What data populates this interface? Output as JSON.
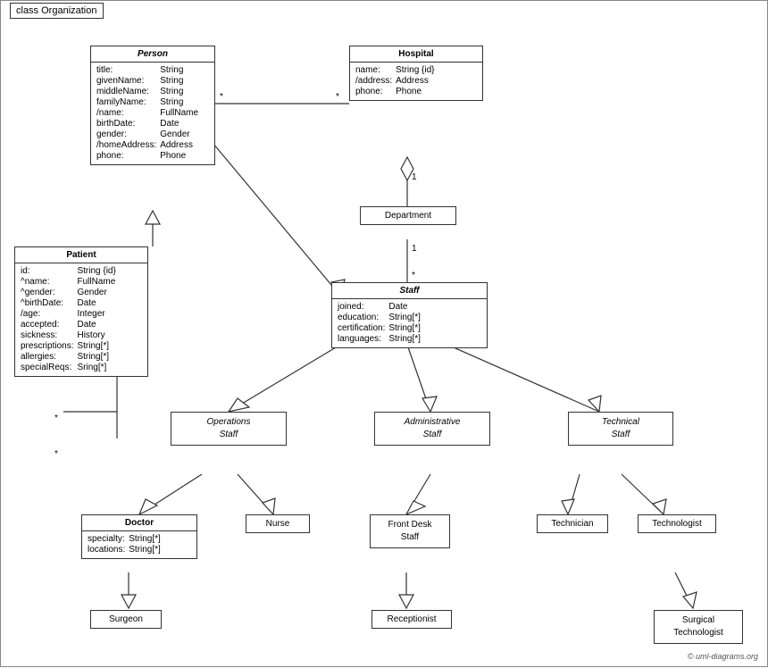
{
  "diagram": {
    "title": "class Organization",
    "classes": {
      "person": {
        "name": "Person",
        "italic": true,
        "attrs": [
          [
            "title:",
            "String"
          ],
          [
            "givenName:",
            "String"
          ],
          [
            "middleName:",
            "String"
          ],
          [
            "familyName:",
            "String"
          ],
          [
            "/name:",
            "FullName"
          ],
          [
            "birthDate:",
            "Date"
          ],
          [
            "gender:",
            "Gender"
          ],
          [
            "/homeAddress:",
            "Address"
          ],
          [
            "phone:",
            "Phone"
          ]
        ]
      },
      "hospital": {
        "name": "Hospital",
        "attrs": [
          [
            "name:",
            "String {id}"
          ],
          [
            "/address:",
            "Address"
          ],
          [
            "phone:",
            "Phone"
          ]
        ]
      },
      "patient": {
        "name": "Patient",
        "attrs": [
          [
            "id:",
            "String {id}"
          ],
          [
            "^name:",
            "FullName"
          ],
          [
            "^gender:",
            "Gender"
          ],
          [
            "^birthDate:",
            "Date"
          ],
          [
            "/age:",
            "Integer"
          ],
          [
            "accepted:",
            "Date"
          ],
          [
            "sickness:",
            "History"
          ],
          [
            "prescriptions:",
            "String[*]"
          ],
          [
            "allergies:",
            "String[*]"
          ],
          [
            "specialReqs:",
            "Sring[*]"
          ]
        ]
      },
      "department": {
        "name": "Department"
      },
      "staff": {
        "name": "Staff",
        "italic": true,
        "attrs": [
          [
            "joined:",
            "Date"
          ],
          [
            "education:",
            "String[*]"
          ],
          [
            "certification:",
            "String[*]"
          ],
          [
            "languages:",
            "String[*]"
          ]
        ]
      },
      "operationsStaff": {
        "name": "Operations\nStaff",
        "italic": true
      },
      "administrativeStaff": {
        "name": "Administrative\nStaff",
        "italic": true
      },
      "technicalStaff": {
        "name": "Technical\nStaff",
        "italic": true
      },
      "doctor": {
        "name": "Doctor",
        "attrs": [
          [
            "specialty:",
            "String[*]"
          ],
          [
            "locations:",
            "String[*]"
          ]
        ]
      },
      "nurse": {
        "name": "Nurse"
      },
      "frontDeskStaff": {
        "name": "Front Desk\nStaff"
      },
      "technician": {
        "name": "Technician"
      },
      "technologist": {
        "name": "Technologist"
      },
      "surgeon": {
        "name": "Surgeon"
      },
      "receptionist": {
        "name": "Receptionist"
      },
      "surgicalTechnologist": {
        "name": "Surgical\nTechnologist"
      }
    },
    "copyright": "© uml-diagrams.org"
  }
}
